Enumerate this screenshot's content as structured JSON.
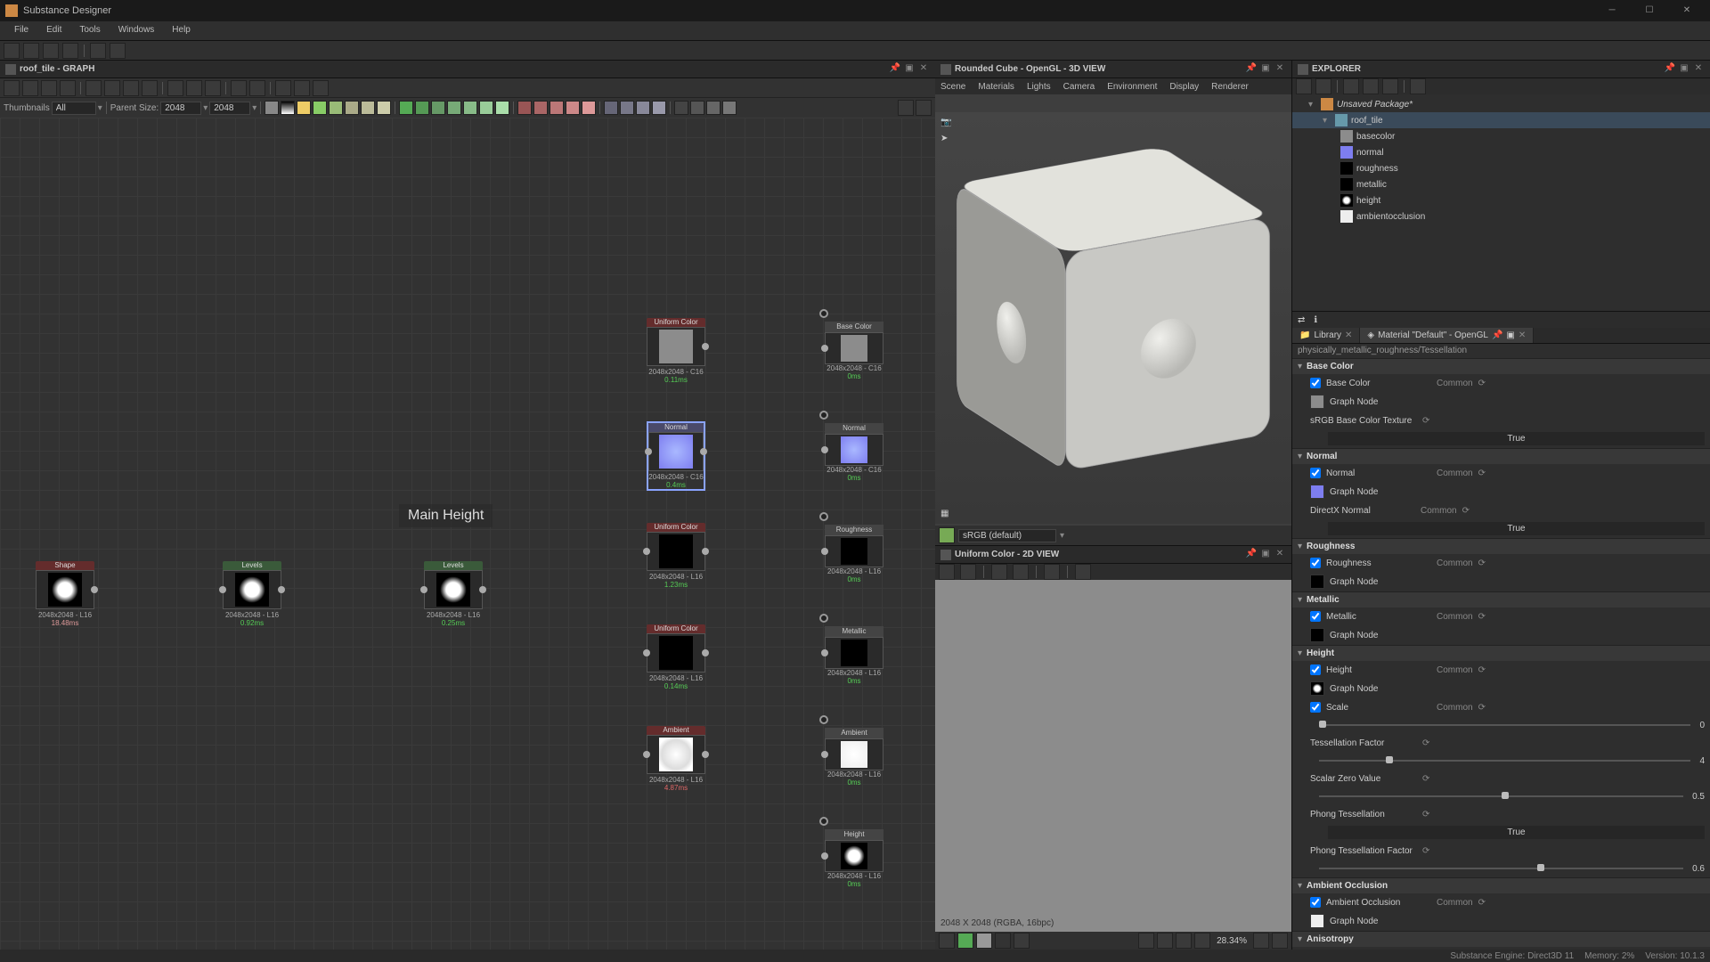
{
  "app": {
    "title": "Substance Designer"
  },
  "menubar": [
    "File",
    "Edit",
    "Tools",
    "Windows",
    "Help"
  ],
  "graph": {
    "title": "roof_tile - GRAPH",
    "thumbnails_label": "Thumbnails",
    "thumbnails_value": "All",
    "parentsize_label": "Parent Size:",
    "parentsize_w": "2048",
    "parentsize_h": "2048",
    "overlay_label": "Main Height",
    "nodes": {
      "shape": {
        "name": "Shape",
        "info": "2048x2048 - L16",
        "ms": "18.48ms",
        "ms_color": "#d99"
      },
      "levels1": {
        "name": "Levels",
        "info": "2048x2048 - L16",
        "ms": "0.92ms",
        "ms_color": "#5c5"
      },
      "levels2": {
        "name": "Levels",
        "info": "2048x2048 - L16",
        "ms": "0.25ms",
        "ms_color": "#5c5"
      },
      "uc1": {
        "name": "Uniform Color",
        "info": "2048x2048 - C16",
        "ms": "0.11ms",
        "ms_color": "#5c5"
      },
      "normal": {
        "name": "Normal",
        "info": "2048x2048 - C16",
        "ms": "0.4ms",
        "ms_color": "#5c5"
      },
      "uc2": {
        "name": "Uniform Color",
        "info": "2048x2048 - L16",
        "ms": "1.23ms",
        "ms_color": "#5c5"
      },
      "uc3": {
        "name": "Uniform Color",
        "info": "2048x2048 - L16",
        "ms": "0.14ms",
        "ms_color": "#5c5"
      },
      "ao": {
        "name": "Ambient Occlusion (HB...",
        "info": "2048x2048 - L16",
        "ms": "4.87ms",
        "ms_color": "#d66"
      }
    },
    "outputs": {
      "basecolor": {
        "name": "Base Color",
        "info": "2048x2048 - C16",
        "ms": "0ms"
      },
      "normal": {
        "name": "Normal",
        "info": "2048x2048 - C16",
        "ms": "0ms"
      },
      "roughness": {
        "name": "Roughness",
        "info": "2048x2048 - L16",
        "ms": "0ms"
      },
      "metallic": {
        "name": "Metallic",
        "info": "2048x2048 - L16",
        "ms": "0ms"
      },
      "ao": {
        "name": "Ambient Occlusion",
        "info": "2048x2048 - L16",
        "ms": "0ms"
      },
      "height": {
        "name": "Height",
        "info": "2048x2048 - L16",
        "ms": "0ms"
      }
    }
  },
  "view3d": {
    "title": "Rounded Cube - OpenGL - 3D VIEW",
    "menu": [
      "Scene",
      "Materials",
      "Lights",
      "Camera",
      "Environment",
      "Display",
      "Renderer"
    ],
    "shader_select": "sRGB (default)"
  },
  "view2d": {
    "title": "Uniform Color - 2D VIEW",
    "info": "2048 X 2048 (RGBA, 16bpc)",
    "zoom": "28.34%"
  },
  "explorer": {
    "title": "EXPLORER",
    "package": "Unsaved Package*",
    "graph": "roof_tile",
    "outputs": [
      "basecolor",
      "normal",
      "roughness",
      "metallic",
      "height",
      "ambientocclusion"
    ]
  },
  "props": {
    "tab_library": "Library",
    "tab_material": "Material \"Default\" - OpenGL",
    "breadcrumb": "physically_metallic_roughness/Tessellation",
    "groups": {
      "basecolor": {
        "title": "Base Color",
        "param": "Base Color",
        "meta": "Common",
        "graphnode": "Graph Node",
        "srgb_label": "sRGB Base Color Texture",
        "srgb_val": "True"
      },
      "normal": {
        "title": "Normal",
        "param": "Normal",
        "meta": "Common",
        "graphnode": "Graph Node",
        "dx_label": "DirectX Normal",
        "dx_meta": "Common",
        "dx_val": "True"
      },
      "roughness": {
        "title": "Roughness",
        "param": "Roughness",
        "meta": "Common",
        "graphnode": "Graph Node"
      },
      "metallic": {
        "title": "Metallic",
        "param": "Metallic",
        "meta": "Common",
        "graphnode": "Graph Node"
      },
      "height": {
        "title": "Height",
        "param": "Height",
        "meta": "Common",
        "graphnode": "Graph Node",
        "scale_label": "Scale",
        "scale_meta": "Common",
        "scale_val": "0",
        "tess_label": "Tessellation Factor",
        "tess_val": "4",
        "szv_label": "Scalar Zero Value",
        "szv_val": "0.5",
        "phong_label": "Phong Tessellation",
        "phong_val": "True",
        "phongf_label": "Phong Tessellation Factor",
        "phongf_val": "0.6"
      },
      "ao": {
        "title": "Ambient Occlusion",
        "param": "Ambient Occlusion",
        "meta": "Common",
        "graphnode": "Graph Node"
      },
      "aniso": {
        "title": "Anisotropy"
      }
    }
  },
  "status": {
    "engine": "Substance Engine: Direct3D 11",
    "memory": "Memory: 2%",
    "version": "Version: 10.1.3"
  },
  "icons": {
    "camera": "camera-icon",
    "cursor": "cursor-icon",
    "grid": "grid-icon",
    "eye": "eye-icon"
  }
}
